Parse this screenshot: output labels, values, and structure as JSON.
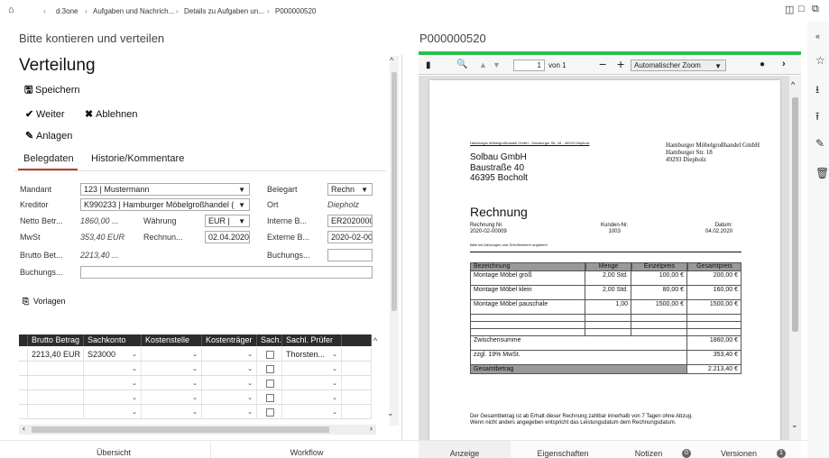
{
  "breadcrumb": {
    "items": [
      "d.3one",
      "Aufgaben und Nachrich...",
      "Details zu Aufgaben un...",
      "P000000520"
    ]
  },
  "left": {
    "header": "Bitte kontieren und verteilen",
    "title": "Verteilung",
    "actions": {
      "save": "Speichern",
      "next": "Weiter",
      "reject": "Ablehnen",
      "attachments": "Anlagen"
    },
    "tabs": [
      "Belegdaten",
      "Historie/Kommentare"
    ],
    "fields": {
      "mandant_label": "Mandant",
      "mandant_value": "123 | Mustermann",
      "kreditor_label": "Kreditor",
      "kreditor_value": "K990233 | Hamburger Möbelgroßhandel (",
      "netto_label": "Netto Betr...",
      "netto_value": "1860,00 ...",
      "waehrung_label": "Währung",
      "waehrung_value": "EUR |",
      "mwst_label": "MwSt",
      "mwst_value": "353,40 EUR",
      "rechnun_label": "Rechnun...",
      "rechnun_value": "02.04.2020",
      "brutto_label": "Brutto Bet...",
      "brutto_value": "2213,40 ...",
      "buchungs_label": "Buchungs...",
      "belegart_label": "Belegart",
      "belegart_value": "Rechn",
      "ort_label": "Ort",
      "ort_value": "Diepholz",
      "interne_label": "Interne B...",
      "interne_value": "ER2020000",
      "externe_label": "Externe B...",
      "externe_value": "2020-02-00",
      "buchungs2_label": "Buchungs..."
    },
    "vorlagen": "Vorlagen",
    "grid": {
      "columns": [
        "Brutto Betrag",
        "Sachkonto",
        "Kostenstelle",
        "Kostenträger",
        "Sach...",
        "Sachl. Prüfer"
      ],
      "rows": [
        {
          "brutto": "2213,40 EUR",
          "sachkonto": "S23000",
          "pruefer": "Thorsten..."
        },
        {
          "brutto": "",
          "sachkonto": "",
          "pruefer": ""
        },
        {
          "brutto": "",
          "sachkonto": "",
          "pruefer": ""
        },
        {
          "brutto": "",
          "sachkonto": "",
          "pruefer": ""
        },
        {
          "brutto": "",
          "sachkonto": "",
          "pruefer": ""
        }
      ]
    },
    "bottom_tabs": [
      "Übersicht",
      "Workflow"
    ]
  },
  "right": {
    "header": "P000000520",
    "toolbar": {
      "page": "1",
      "of": "von 1",
      "zoom": "Automatischer Zoom"
    },
    "bottom_tabs": [
      {
        "label": "Anzeige"
      },
      {
        "label": "Eigenschaften"
      },
      {
        "label": "Notizen",
        "badge": "0"
      },
      {
        "label": "Versionen",
        "badge": "1"
      }
    ]
  },
  "invoice": {
    "sender_line": "Hamburger Möbelgroßhandel GmbH - Hamburger Str. 18 - 49293 Diepholz",
    "sender_block": [
      "Hamburger Möbelgroßhandel GmbH",
      "Hamburger Str. 18",
      "49293 Diepholz"
    ],
    "recipient": [
      "Solbau GmbH",
      "Baustraße 40",
      "46395 Bocholt"
    ],
    "heading": "Rechnung",
    "nr_label": "Rechnung Nr.",
    "nr_value": "2020-02-00009",
    "kunden_label": "Kunden-Nr.",
    "kunden_value": "1003",
    "datum_label": "Datum:",
    "datum_value": "04.02.2020",
    "note": "Bitte bei Zahlungen und Schriftverkehr angeben!",
    "columns": [
      "Bezeichnung",
      "Menge",
      "Einzelpreis",
      "Gesamtpreis"
    ],
    "items": [
      {
        "desc": "Montage Möbel groß",
        "qty": "2,00 Std.",
        "unit": "100,00 €",
        "total": "200,00 €"
      },
      {
        "desc": "Montage Möbel klein",
        "qty": "2,00 Std.",
        "unit": "80,00 €",
        "total": "160,00 €"
      },
      {
        "desc": "Montage Möbel pauschale",
        "qty": "1,00",
        "unit": "1500,00 €",
        "total": "1500,00 €"
      }
    ],
    "subtotal_label": "Zwischensumme",
    "subtotal": "1860,00 €",
    "vat_label": "zzgl. 19% MwSt.",
    "vat": "353,40 €",
    "total_label": "Gesamtbetrag",
    "total": "2.213,40 €",
    "footer": [
      "Der Gesamtbetrag ist ab Erhalt dieser Rechnung zahlbar innerhalb von 7 Tagen ohne Abzug.",
      "Wenn nicht anders angegeben entspricht das Leistungsdatum dem Rechnungsdatum."
    ]
  },
  "colors": {
    "accent_green": "#2bbf4b",
    "grid_header": "#2c2c2c",
    "badge": "#666666"
  }
}
